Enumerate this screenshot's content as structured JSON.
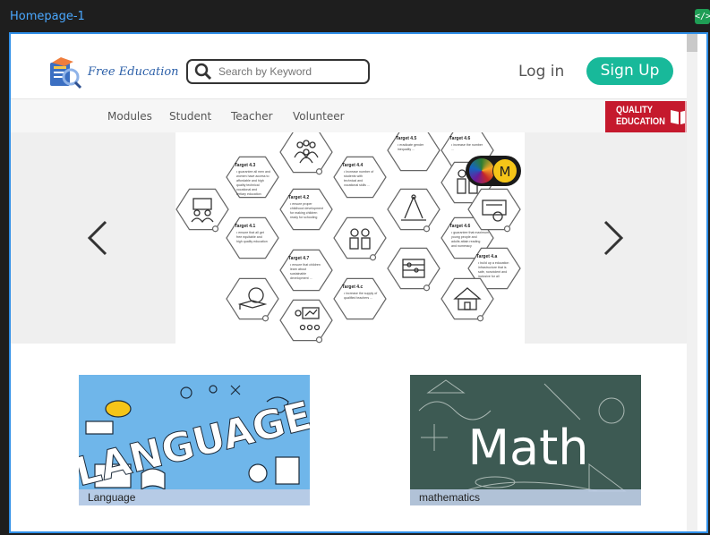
{
  "frame": {
    "name": "Homepage-1",
    "code_badge": "</>"
  },
  "header": {
    "logo_text": "Free Education",
    "search_placeholder": "Search by Keyword",
    "login_label": "Log in",
    "signup_label": "Sign Up"
  },
  "nav": {
    "items": [
      "Modules",
      "Student",
      "Teacher",
      "Volunteer"
    ],
    "quality_badge": {
      "line1": "QUALITY",
      "line2": "EDUCATION"
    }
  },
  "carousel": {
    "targets": [
      {
        "title": "Target 4.3",
        "text": "guarantee all men and women have access to affordable and high quality technical vocational and tertiary education"
      },
      {
        "title": "Target 4.2",
        "text": "ensure proper childhood development for making children ready for schooling"
      },
      {
        "title": "Target 4.1",
        "text": "ensure that all get free equitable and high quality education"
      },
      {
        "title": "Target 4.4",
        "text": "Increase number of students with technical and vocational skills ..."
      },
      {
        "title": "Target 4.7",
        "text": "ensure that children learn about sustainable development ..."
      },
      {
        "title": "Target 4.c",
        "text": "increase the supply of qualified teachers ..."
      },
      {
        "title": "Target 4.5",
        "text": "eradicate gender inequality ..."
      },
      {
        "title": "Target 4.6",
        "text": "guarantee that maximum young people and adults attain reading and numeracy"
      },
      {
        "title": "Target 4.6",
        "text": "increase the number ..."
      },
      {
        "title": "Target 4.a",
        "text": "build up a education infrastructure that is safe, nonviolent and inclusive for all"
      }
    ],
    "avatar_initial": "M"
  },
  "cards": [
    {
      "label": "Language",
      "image_word": "LANGUAGE"
    },
    {
      "label": "mathematics",
      "image_word": "Math"
    }
  ],
  "colors": {
    "brand": "#18b99a",
    "frame_border": "#2f8fe8",
    "quality_red": "#c5192d",
    "language_bg": "#6fb6ea",
    "math_bg": "#3d5a53"
  }
}
